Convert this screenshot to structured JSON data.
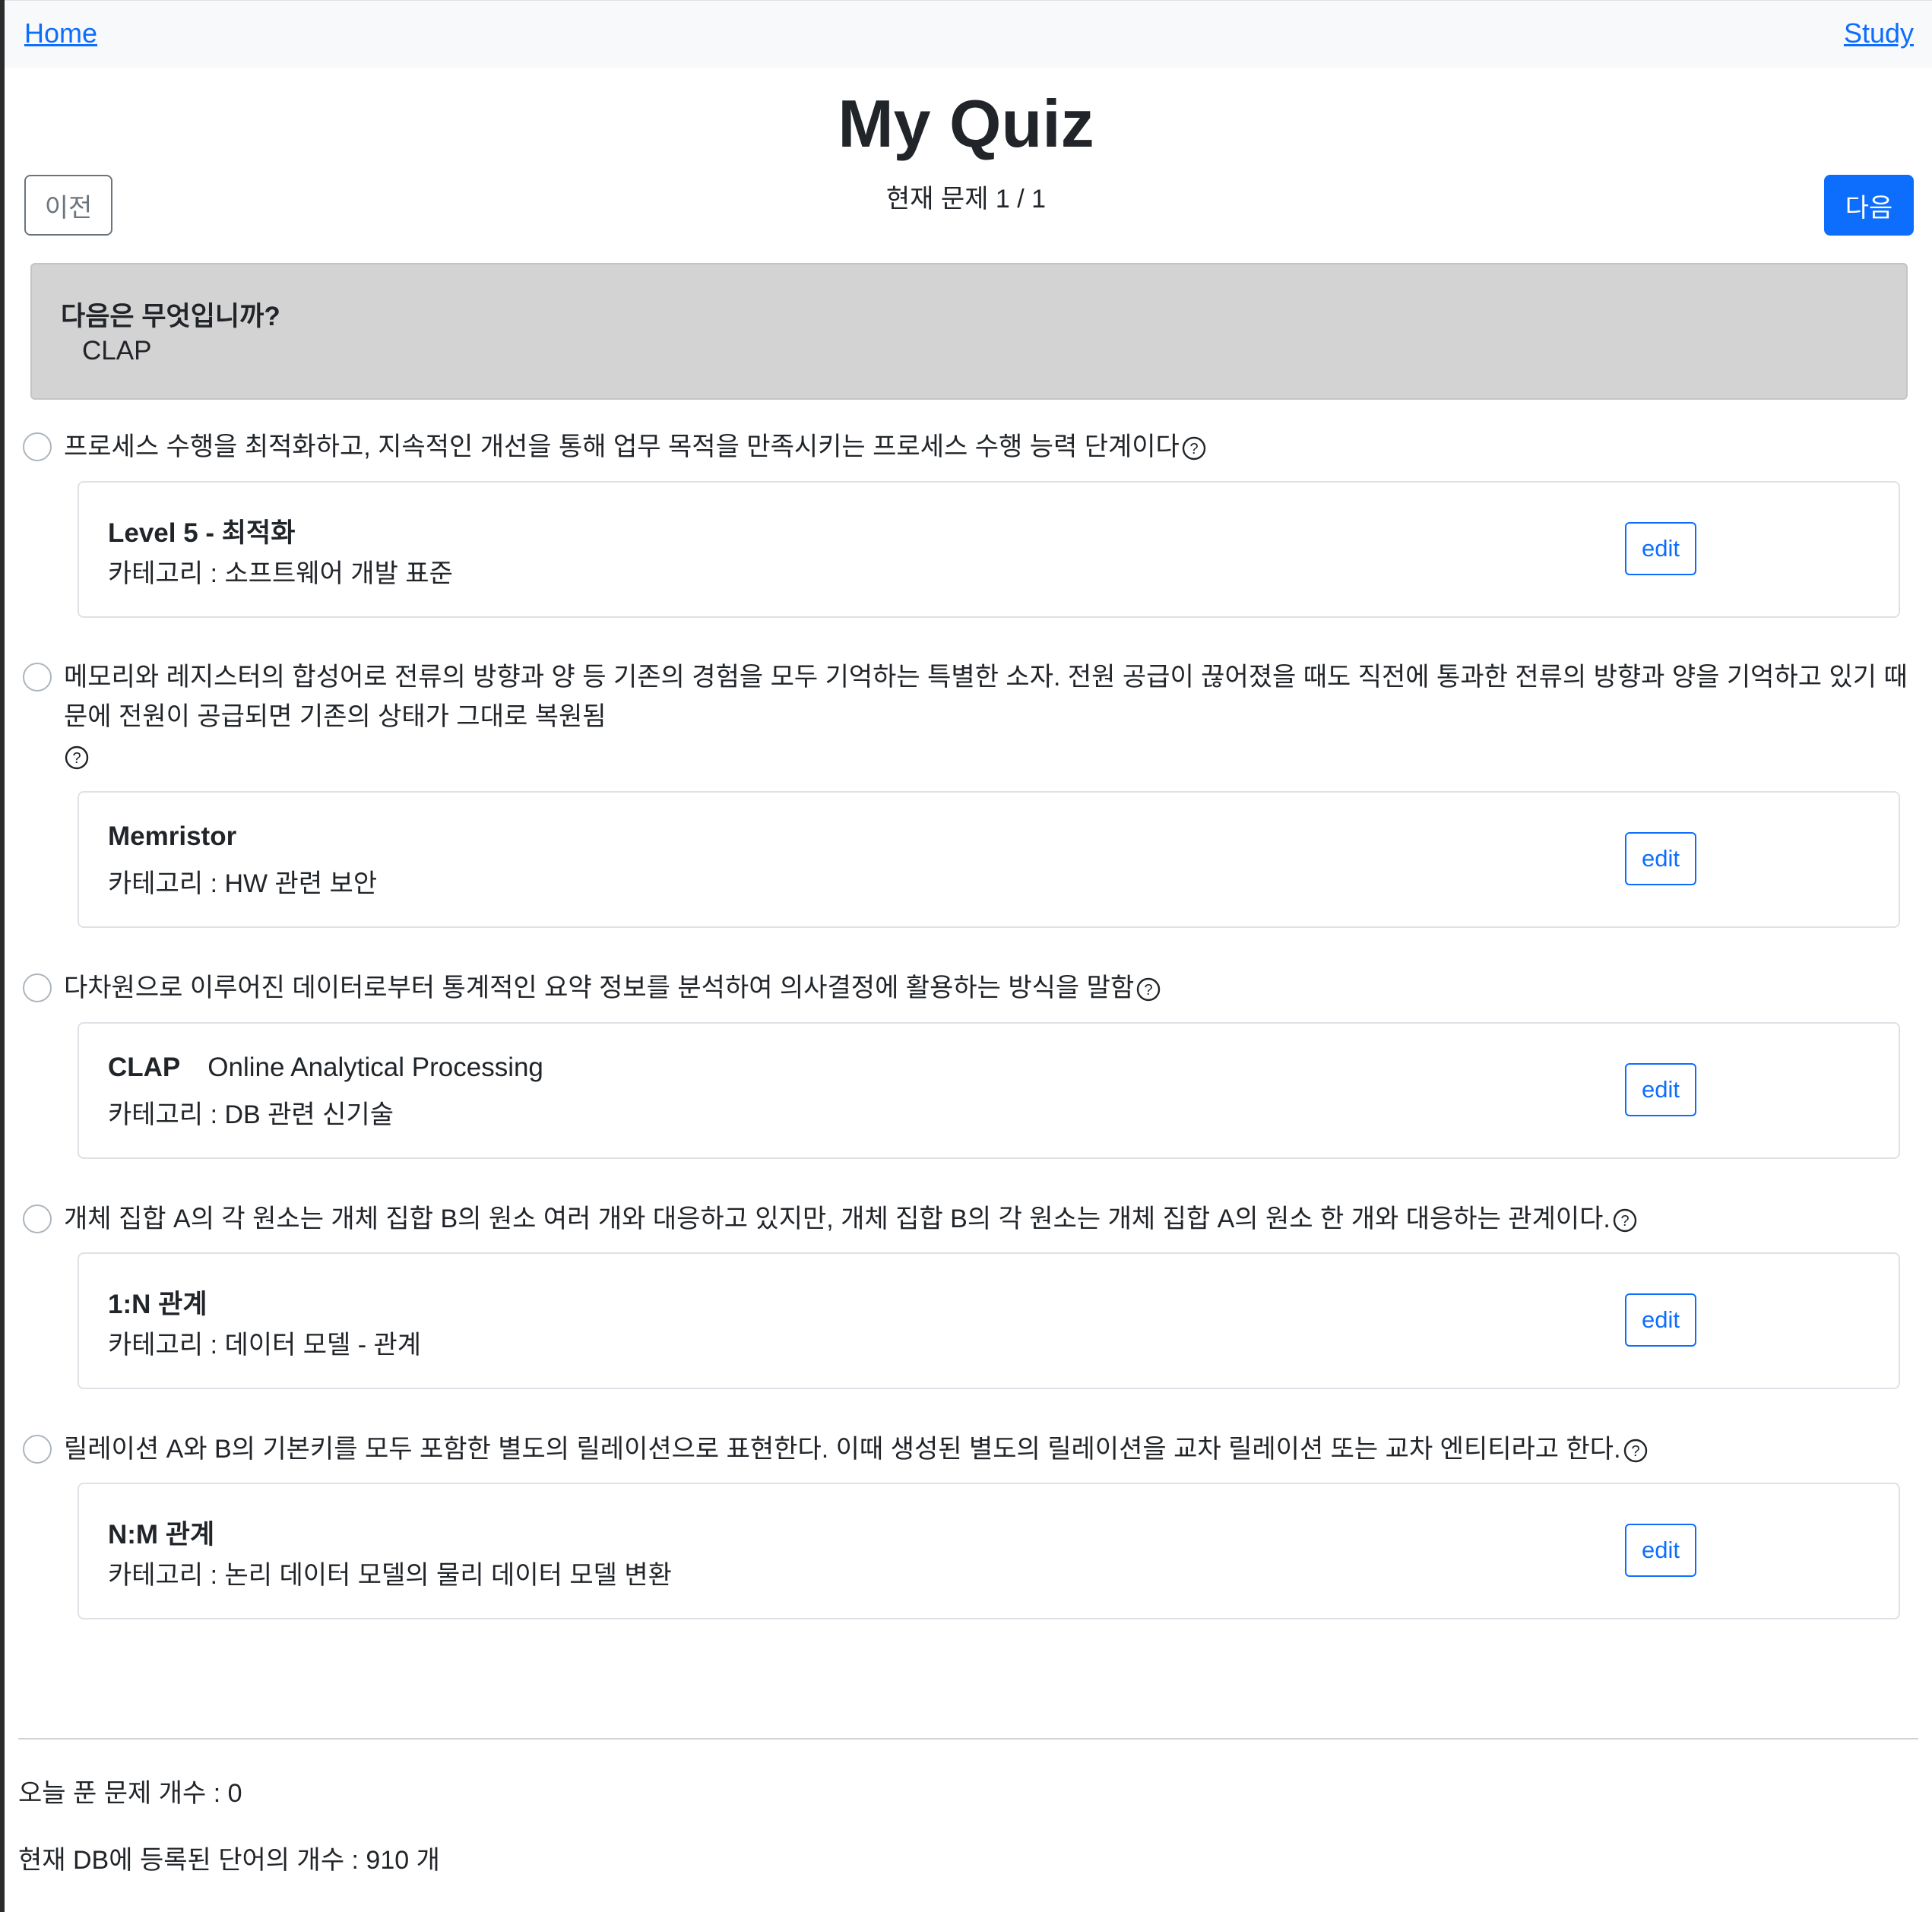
{
  "nav": {
    "home": "Home",
    "study": "Study"
  },
  "title": "My Quiz",
  "controls": {
    "prev": "이전",
    "next": "다음",
    "progress": "현재 문제 1 / 1"
  },
  "question": {
    "label": "다음은 무엇입니까?",
    "term": "CLAP"
  },
  "options": [
    {
      "definition": "프로세스 수행을 최적화하고, 지속적인 개선을 통해 업무 목적을 만족시키는 프로세스 수행 능력 단계이다",
      "term": "Level 5 - 최적화",
      "term_sub": "",
      "category": "카테고리 : 소프트웨어 개발 표준",
      "edit": "edit"
    },
    {
      "definition": "메모리와 레지스터의 합성어로 전류의 방향과 양 등 기존의 경험을 모두 기억하는 특별한 소자. 전원 공급이 끊어졌을 때도 직전에 통과한 전류의 방향과 양을 기억하고 있기 때문에 전원이 공급되면 기존의 상태가 그대로 복원됨",
      "term": "Memristor",
      "term_sub": "",
      "category": "카테고리 : HW 관련 보안",
      "edit": "edit"
    },
    {
      "definition": "다차원으로 이루어진 데이터로부터 통계적인 요약 정보를 분석하여 의사결정에 활용하는 방식을 말함",
      "term": "CLAP",
      "term_sub": "Online Analytical Processing",
      "category": "카테고리 : DB 관련 신기술",
      "edit": "edit"
    },
    {
      "definition": "개체 집합 A의 각 원소는 개체 집합 B의 원소 여러 개와 대응하고 있지만, 개체 집합 B의 각 원소는 개체 집합 A의 원소 한 개와 대응하는 관계이다.",
      "term": "1:N 관계",
      "term_sub": "",
      "category": "카테고리 : 데이터 모델 - 관계",
      "edit": "edit"
    },
    {
      "definition": "릴레이션 A와 B의 기본키를 모두 포함한 별도의 릴레이션으로 표현한다. 이때 생성된 별도의 릴레이션을 교차 릴레이션 또는 교차 엔티티라고 한다.",
      "term": "N:M 관계",
      "term_sub": "",
      "category": "카테고리 : 논리 데이터 모델의 물리 데이터 모델 변환",
      "edit": "edit"
    }
  ],
  "stats": {
    "solved_today": "오늘 푼 문제 개수 : 0",
    "db_count": "현재 DB에 등록된 단어의 개수 : 910 개"
  },
  "colors": {
    "primary": "#0d6efd",
    "question_bg": "#d3d3d3",
    "secondary": "#6c757d"
  }
}
